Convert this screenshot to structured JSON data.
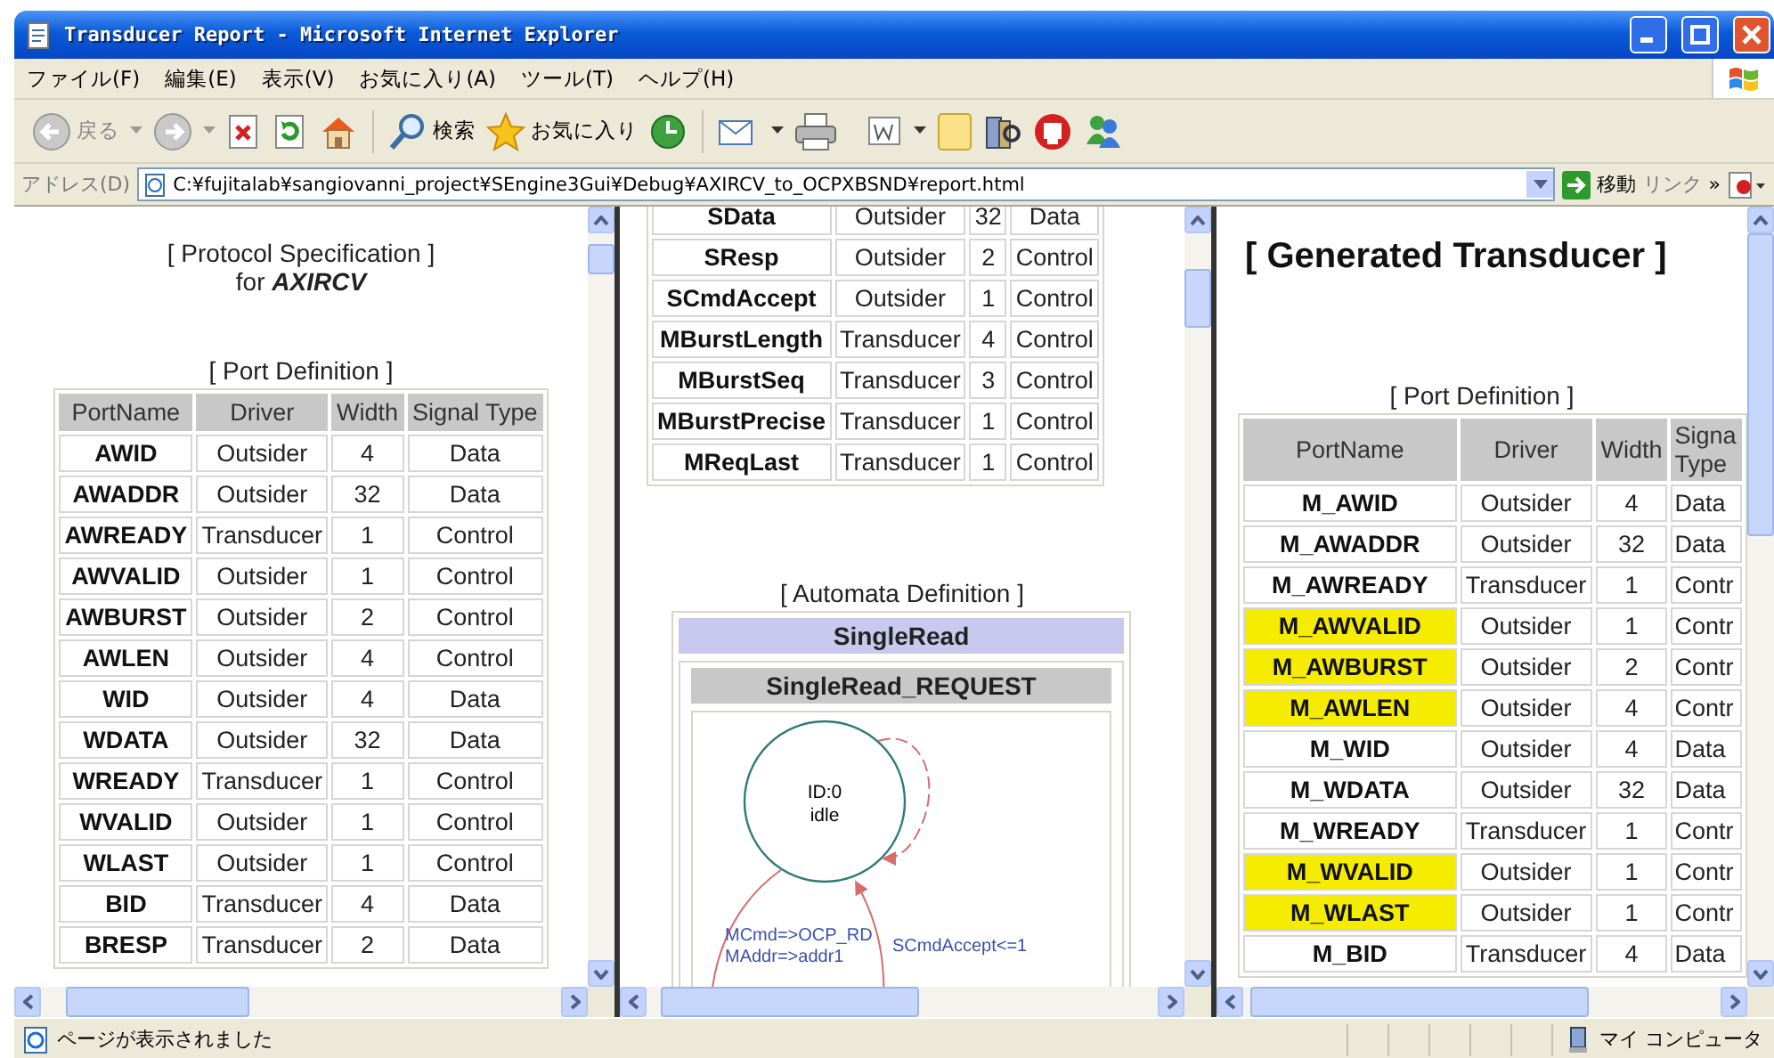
{
  "window": {
    "title": "Transducer Report - Microsoft Internet Explorer"
  },
  "menu": [
    "ファイル(F)",
    "編集(E)",
    "表示(V)",
    "お気に入り(A)",
    "ツール(T)",
    "ヘルプ(H)"
  ],
  "toolbar": {
    "back": "戻る",
    "search": "検索",
    "favorites": "お気に入り"
  },
  "address": {
    "label": "アドレス(D)",
    "value": "C:¥fujitalab¥sangiovanni_project¥SEngine3Gui¥Debug¥AXIRCV_to_OCPXBSND¥report.html",
    "go": "移動",
    "links": "リンク",
    "more": "»"
  },
  "frames": [
    {
      "kind": "specification",
      "heading": "[ Protocol Specification ]",
      "subheading": "for **AXIRCV**",
      "section": "[ Port Definition ]",
      "table": {
        "columns": [
          "PortName",
          "Driver",
          "Width",
          "Signal Type"
        ],
        "rows": [
          {
            "cells": [
              "AWID",
              "Outsider",
              "4",
              "Data"
            ]
          },
          {
            "cells": [
              "AWADDR",
              "Outsider",
              "32",
              "Data"
            ]
          },
          {
            "cells": [
              "AWREADY",
              "Transducer",
              "1",
              "Control"
            ]
          },
          {
            "cells": [
              "AWVALID",
              "Outsider",
              "1",
              "Control"
            ]
          },
          {
            "cells": [
              "AWBURST",
              "Outsider",
              "2",
              "Control"
            ]
          },
          {
            "cells": [
              "AWLEN",
              "Outsider",
              "4",
              "Control"
            ]
          },
          {
            "cells": [
              "WID",
              "Outsider",
              "4",
              "Data"
            ]
          },
          {
            "cells": [
              "WDATA",
              "Outsider",
              "32",
              "Data"
            ]
          },
          {
            "cells": [
              "WREADY",
              "Transducer",
              "1",
              "Control"
            ]
          },
          {
            "cells": [
              "WVALID",
              "Outsider",
              "1",
              "Control"
            ]
          },
          {
            "cells": [
              "WLAST",
              "Outsider",
              "1",
              "Control"
            ]
          },
          {
            "cells": [
              "BID",
              "Transducer",
              "4",
              "Data"
            ]
          },
          {
            "cells": [
              "BRESP",
              "Transducer",
              "2",
              "Data"
            ]
          }
        ]
      }
    },
    {
      "kind": "specification",
      "table": {
        "rows": [
          {
            "cells": [
              "SData",
              "Outsider",
              "32",
              "Data"
            ]
          },
          {
            "cells": [
              "SResp",
              "Outsider",
              "2",
              "Control"
            ]
          },
          {
            "cells": [
              "SCmdAccept",
              "Outsider",
              "1",
              "Control"
            ]
          },
          {
            "cells": [
              "MBurstLength",
              "Transducer",
              "4",
              "Control"
            ]
          },
          {
            "cells": [
              "MBurstSeq",
              "Transducer",
              "3",
              "Control"
            ]
          },
          {
            "cells": [
              "MBurstPrecise",
              "Transducer",
              "1",
              "Control"
            ]
          },
          {
            "cells": [
              "MReqLast",
              "Transducer",
              "1",
              "Control"
            ]
          }
        ]
      },
      "section": "[ Automata Definition ]",
      "automaton": {
        "name": "SingleRead",
        "group": "SingleRead_REQUEST",
        "state": {
          "id": "ID:0",
          "name": "idle"
        },
        "transitions": [
          {
            "lines": [
              "MCmd=>OCP_RD",
              "MAddr=>addr1"
            ]
          },
          {
            "lines": [
              "SCmdAccept<=1"
            ]
          }
        ]
      }
    },
    {
      "kind": "transducer",
      "heading": "[ Generated Transducer ]",
      "section": "[ Port Definition ]",
      "table": {
        "columns": [
          "PortName",
          "Driver",
          "Width",
          "Signa Type"
        ],
        "rows": [
          {
            "cells": [
              "M_AWID",
              "Outsider",
              "4",
              "Data"
            ],
            "highlighted": false
          },
          {
            "cells": [
              "M_AWADDR",
              "Outsider",
              "32",
              "Data"
            ],
            "highlighted": false
          },
          {
            "cells": [
              "M_AWREADY",
              "Transducer",
              "1",
              "Contr"
            ],
            "highlighted": false
          },
          {
            "cells": [
              "M_AWVALID",
              "Outsider",
              "1",
              "Contr"
            ],
            "highlighted": true
          },
          {
            "cells": [
              "M_AWBURST",
              "Outsider",
              "2",
              "Contr"
            ],
            "highlighted": true
          },
          {
            "cells": [
              "M_AWLEN",
              "Outsider",
              "4",
              "Contr"
            ],
            "highlighted": true
          },
          {
            "cells": [
              "M_WID",
              "Outsider",
              "4",
              "Data"
            ],
            "highlighted": false
          },
          {
            "cells": [
              "M_WDATA",
              "Outsider",
              "32",
              "Data"
            ],
            "highlighted": false
          },
          {
            "cells": [
              "M_WREADY",
              "Transducer",
              "1",
              "Contr"
            ],
            "highlighted": false
          },
          {
            "cells": [
              "M_WVALID",
              "Outsider",
              "1",
              "Contr"
            ],
            "highlighted": true
          },
          {
            "cells": [
              "M_WLAST",
              "Outsider",
              "1",
              "Contr"
            ],
            "highlighted": true
          },
          {
            "cells": [
              "M_BID",
              "Transducer",
              "4",
              "Data"
            ],
            "highlighted": false
          }
        ]
      }
    }
  ],
  "status_bar": {
    "message": "ページが表示されました",
    "zone": "マイ コンピュータ"
  }
}
